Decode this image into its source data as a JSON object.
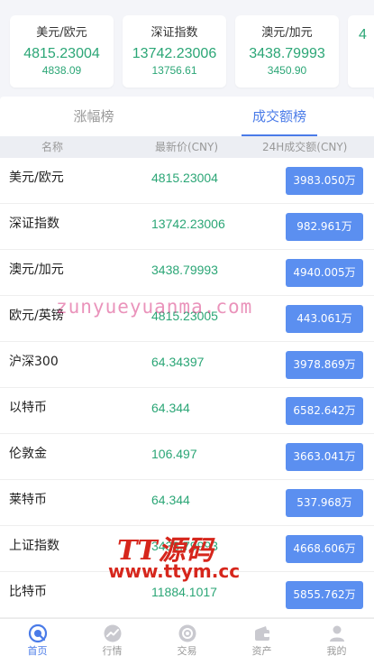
{
  "tickers": [
    {
      "name": "美元/欧元",
      "price": "4815.23004",
      "sub": "4838.09"
    },
    {
      "name": "深证指数",
      "price": "13742.23006",
      "sub": "13756.61"
    },
    {
      "name": "澳元/加元",
      "price": "3438.79993",
      "sub": "3450.90"
    },
    {
      "name": "",
      "price": "4",
      "sub": ""
    }
  ],
  "tabs": [
    {
      "label": "涨幅榜",
      "active": false
    },
    {
      "label": "成交额榜",
      "active": true
    }
  ],
  "columns": {
    "name": "名称",
    "price": "最新价(CNY)",
    "volume": "24H成交额(CNY)"
  },
  "rows": [
    {
      "name": "美元/欧元",
      "price": "4815.23004",
      "volume": "3983.050万"
    },
    {
      "name": "深证指数",
      "price": "13742.23006",
      "volume": "982.961万"
    },
    {
      "name": "澳元/加元",
      "price": "3438.79993",
      "volume": "4940.005万"
    },
    {
      "name": "欧元/英镑",
      "price": "4815.23005",
      "volume": "443.061万"
    },
    {
      "name": "沪深300",
      "price": "64.34397",
      "volume": "3978.869万"
    },
    {
      "name": "以特币",
      "price": "64.344",
      "volume": "6582.642万"
    },
    {
      "name": "伦敦金",
      "price": "106.497",
      "volume": "3663.041万"
    },
    {
      "name": "莱特币",
      "price": "64.344",
      "volume": "537.968万"
    },
    {
      "name": "上证指数",
      "price": "3438.79993",
      "volume": "4668.606万"
    },
    {
      "name": "比特币",
      "price": "11884.1017",
      "volume": "5855.762万"
    }
  ],
  "watermarks": {
    "text": "zunyueyuanma.com",
    "logo_title": "TT源码",
    "logo_url": "www.ttym.cc"
  },
  "nav": [
    {
      "label": "首页",
      "icon": "home-icon",
      "active": true
    },
    {
      "label": "行情",
      "icon": "market-icon",
      "active": false
    },
    {
      "label": "交易",
      "icon": "trade-icon",
      "active": false
    },
    {
      "label": "资产",
      "icon": "wallet-icon",
      "active": false
    },
    {
      "label": "我的",
      "icon": "user-icon",
      "active": false
    }
  ],
  "colors": {
    "accent": "#4a7be8",
    "up": "#2ba676",
    "volume_button": "#5b8ff0",
    "watermark": "#d6261c"
  }
}
